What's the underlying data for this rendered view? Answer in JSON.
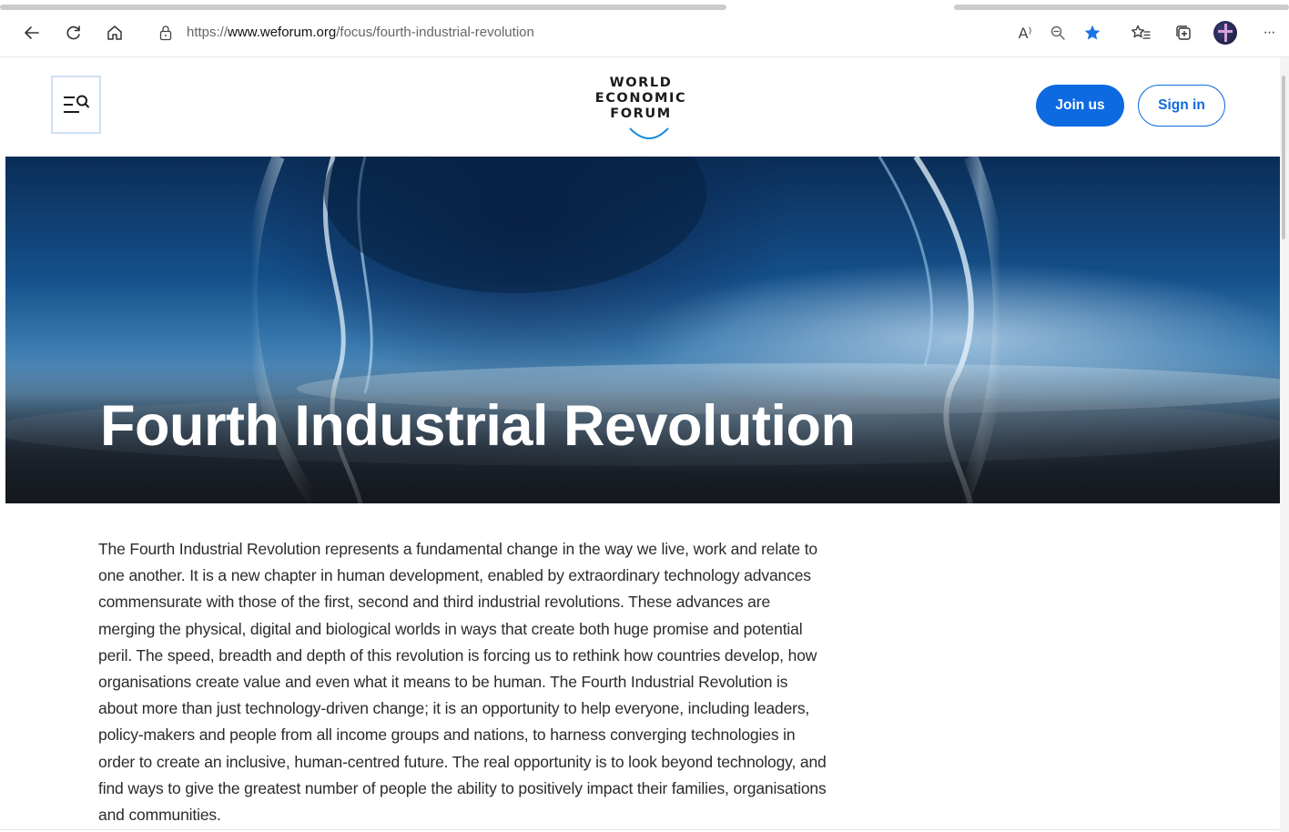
{
  "browser": {
    "url_prefix": "https://",
    "url_host": "www.weforum.org",
    "url_path": "/focus/fourth-industrial-revolution",
    "read_aloud_label": "A⁾",
    "icons": {
      "back": "back-arrow-icon",
      "refresh": "refresh-icon",
      "home": "home-icon",
      "lock": "lock-icon",
      "zoom": "zoom-out-icon",
      "favorite": "star-filled-icon",
      "favorites_list": "favorites-icon",
      "collections": "collections-icon",
      "profile": "profile-avatar",
      "more": "more-icon"
    },
    "more_label": "···"
  },
  "header": {
    "logo_lines": [
      "WORLD",
      "ECONOMIC",
      "FORUM"
    ],
    "join_label": "Join us",
    "signin_label": "Sign in"
  },
  "hero": {
    "title": "Fourth Industrial Revolution"
  },
  "intro": {
    "text": "The Fourth Industrial Revolution represents a fundamental change in the way we live, work and relate to one another. It is a new chapter in human development, enabled by extraordinary technology advances commensurate with those of the first, second and third industrial revolutions. These advances are merging the physical, digital and biological worlds in ways that create both huge promise and potential peril. The speed, breadth and depth of this revolution is forcing us to rethink how countries develop, how organisations create value and even what it means to be human. The Fourth Industrial Revolution is about more than just technology-driven change; it is an opportunity to help everyone, including leaders, policy-makers and people from all income groups and nations, to harness converging technologies in order to create an inclusive, human-centred future. The real opportunity is to look beyond technology, and find ways to give the greatest number of people the ability to positively impact their families, organisations and communities."
  },
  "colors": {
    "brand_blue": "#0d6ae0",
    "favorite_star": "#1a73e8"
  }
}
